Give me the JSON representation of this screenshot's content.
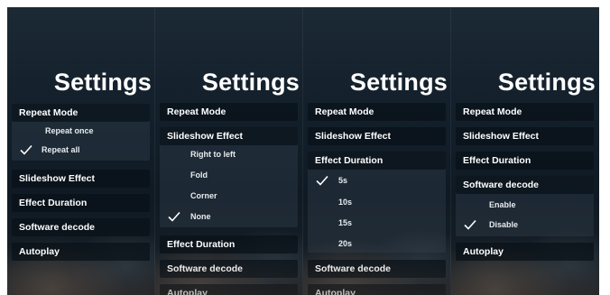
{
  "panels": [
    {
      "title": "Settings",
      "repeat_mode": "Repeat Mode",
      "options": [
        "Repeat once",
        "Repeat all"
      ],
      "selected": "Repeat all",
      "rows_after": [
        "Slideshow Effect",
        "Effect Duration",
        "Software decode",
        "Autoplay"
      ]
    },
    {
      "title": "Settings",
      "repeat_mode": "Repeat Mode",
      "slideshow_effect": "Slideshow Effect",
      "options": [
        "Right to left",
        "Fold",
        "Corner",
        "None"
      ],
      "selected": "None",
      "rows_after": [
        "Effect Duration",
        "Software decode",
        "Autoplay"
      ]
    },
    {
      "title": "Settings",
      "repeat_mode": "Repeat Mode",
      "slideshow_effect": "Slideshow Effect",
      "effect_duration": "Effect Duration",
      "options": [
        "5s",
        "10s",
        "15s",
        "20s"
      ],
      "selected": "5s",
      "rows_after": [
        "Software decode",
        "Autoplay"
      ]
    },
    {
      "title": "Settings",
      "repeat_mode": "Repeat Mode",
      "slideshow_effect": "Slideshow Effect",
      "effect_duration": "Effect Duration",
      "software_decode": "Software decode",
      "options": [
        "Enable",
        "Disable"
      ],
      "selected": "Disable",
      "rows_after": [
        "Autoplay"
      ]
    }
  ],
  "icons": {
    "check": "checkmark-icon"
  },
  "colors": {
    "text": "#ffffff",
    "row_bg": "#08101b",
    "group_bg": "#374652"
  }
}
